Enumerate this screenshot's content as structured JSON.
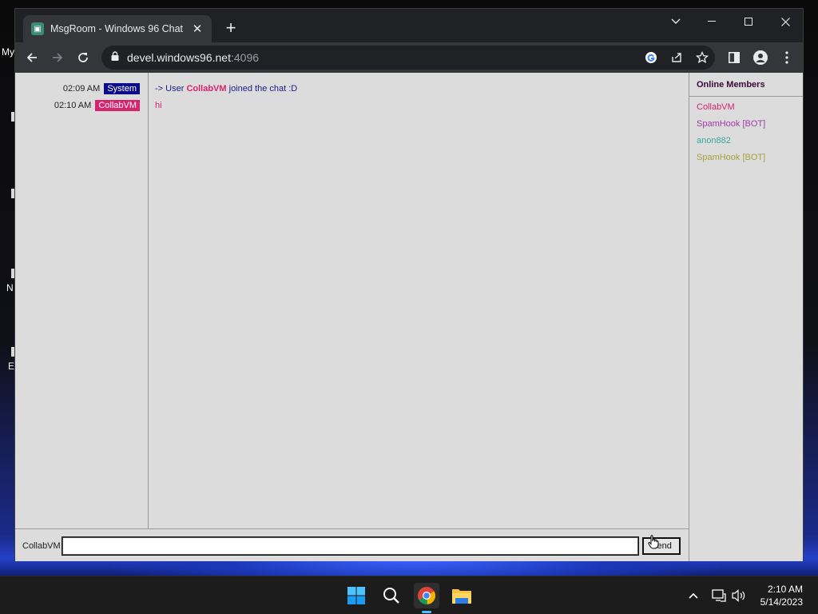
{
  "desktop": {
    "fragments": [
      "My",
      "N",
      "E"
    ]
  },
  "browser": {
    "tab_title": "MsgRoom - Windows 96 Chat",
    "favicon_icon": "msgroom-favicon",
    "url_host": "devel.windows96.net",
    "url_port": ":4096"
  },
  "chat": {
    "timestamps": [
      {
        "time": "02:09 AM",
        "user": "System",
        "color": "#0a0a8a"
      },
      {
        "time": "02:10 AM",
        "user": "CollabVM",
        "color": "#d6246e"
      }
    ],
    "messages": {
      "join_prefix": "-> User ",
      "join_user": "CollabVM",
      "join_suffix": " joined the chat :D",
      "user_message": "hi",
      "user_message_color": "#d6246e"
    },
    "members_title": "Online Members",
    "members": [
      {
        "name": "CollabVM",
        "color": "#d6246e"
      },
      {
        "name": "SpamHook [BOT]",
        "color": "#a23aa8"
      },
      {
        "name": "anon882",
        "color": "#3aa8a0"
      },
      {
        "name": "SpamHook [BOT]",
        "color": "#a8a03a"
      }
    ],
    "composer_name": "CollabVM",
    "input_value": "",
    "send_label": "Send"
  },
  "taskbar": {
    "time": "2:10 AM",
    "date": "5/14/2023"
  }
}
